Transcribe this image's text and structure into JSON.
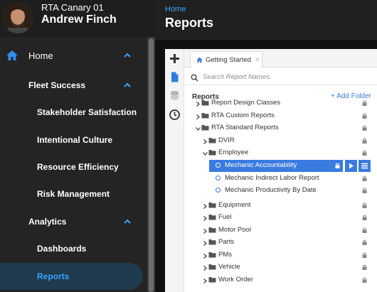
{
  "user": {
    "org": "RTA Canary 01",
    "name": "Andrew Finch"
  },
  "sidebar": {
    "items": [
      {
        "label": "Home"
      },
      {
        "label": "Fleet Success"
      },
      {
        "label": "Stakeholder Satisfaction"
      },
      {
        "label": "Intentional Culture"
      },
      {
        "label": "Resource Efficiency"
      },
      {
        "label": "Risk Management"
      },
      {
        "label": "Analytics"
      },
      {
        "label": "Dashboards"
      },
      {
        "label": "Reports"
      }
    ]
  },
  "header": {
    "breadcrumb": "Home",
    "title": "Reports"
  },
  "panel": {
    "tab_label": "Getting Started",
    "search_placeholder": "Search Report Names.",
    "reports_header": "Reports",
    "add_folder": "+ Add Folder",
    "tree": [
      {
        "label": "Report Design Classes"
      },
      {
        "label": "RTA Custom Reports"
      },
      {
        "label": "RTA Standard Reports"
      },
      {
        "label": "DVIR"
      },
      {
        "label": "Employee"
      },
      {
        "label": "Mechanic Accountability"
      },
      {
        "label": "Mechanic Indirect Labor Report"
      },
      {
        "label": "Mechanic Productivity By Date"
      },
      {
        "label": "Equipment"
      },
      {
        "label": "Fuel"
      },
      {
        "label": "Motor Pool"
      },
      {
        "label": "Parts"
      },
      {
        "label": "PMs"
      },
      {
        "label": "Vehicle"
      },
      {
        "label": "Work Order"
      }
    ]
  },
  "colors": {
    "accent": "#3a7be0",
    "sidebar_active": "#3aa3ff"
  }
}
